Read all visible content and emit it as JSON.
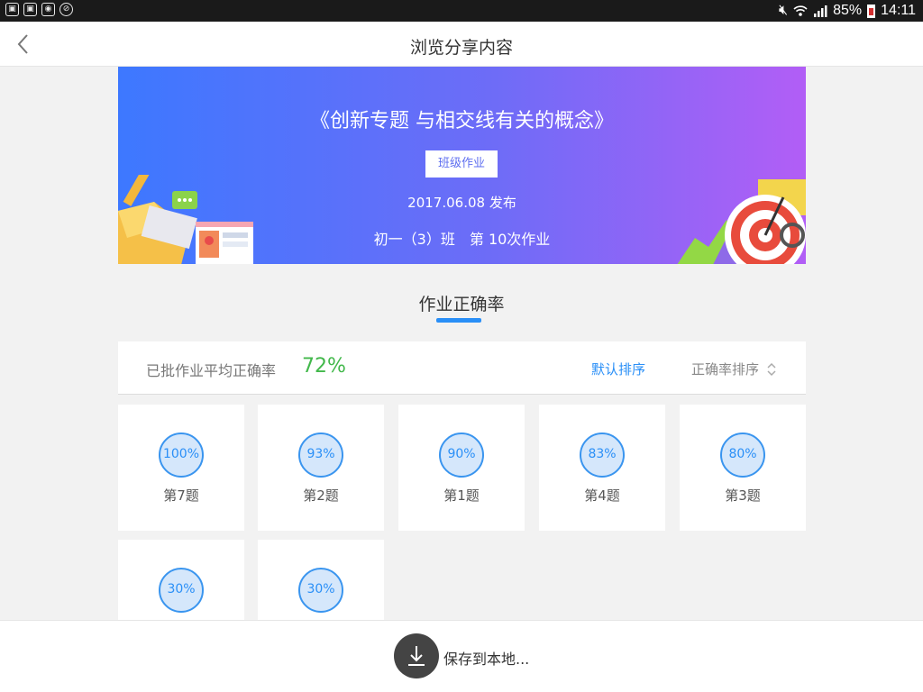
{
  "status_bar": {
    "battery": "85%",
    "time": "14:11",
    "left_icons": [
      "gallery-icon",
      "gallery-icon",
      "android-icon",
      "blocked-icon"
    ],
    "right_icons": [
      "mute-icon",
      "wifi-icon",
      "signal-icon",
      "battery-icon"
    ]
  },
  "header": {
    "title": "浏览分享内容",
    "back_icon": "chevron-left-icon"
  },
  "banner": {
    "title": "《创新专题 与相交线有关的概念》",
    "tag": "班级作业",
    "date": "2017.06.08 发布",
    "class_info": "初一（3）班　第 10次作业",
    "gradient_colors": [
      "#3d78ff",
      "#6e6cf7",
      "#b25ef6"
    ]
  },
  "section": {
    "title": "作业正确率",
    "accent": "#2a8ff7"
  },
  "summary": {
    "label": "已批作业平均正确率",
    "value": "72%",
    "value_color": "#42b84b",
    "sort_default": "默认排序",
    "sort_by_rate": "正确率排序",
    "sort_icon": "sort-updown-icon"
  },
  "questions": [
    {
      "rate": "100%",
      "label": "第7题"
    },
    {
      "rate": "93%",
      "label": "第2题"
    },
    {
      "rate": "90%",
      "label": "第1题"
    },
    {
      "rate": "83%",
      "label": "第4题"
    },
    {
      "rate": "80%",
      "label": "第3题"
    },
    {
      "rate": "30%",
      "label": ""
    },
    {
      "rate": "30%",
      "label": ""
    }
  ],
  "bottom": {
    "save_label": "保存到本地...",
    "save_icon": "download-icon"
  }
}
